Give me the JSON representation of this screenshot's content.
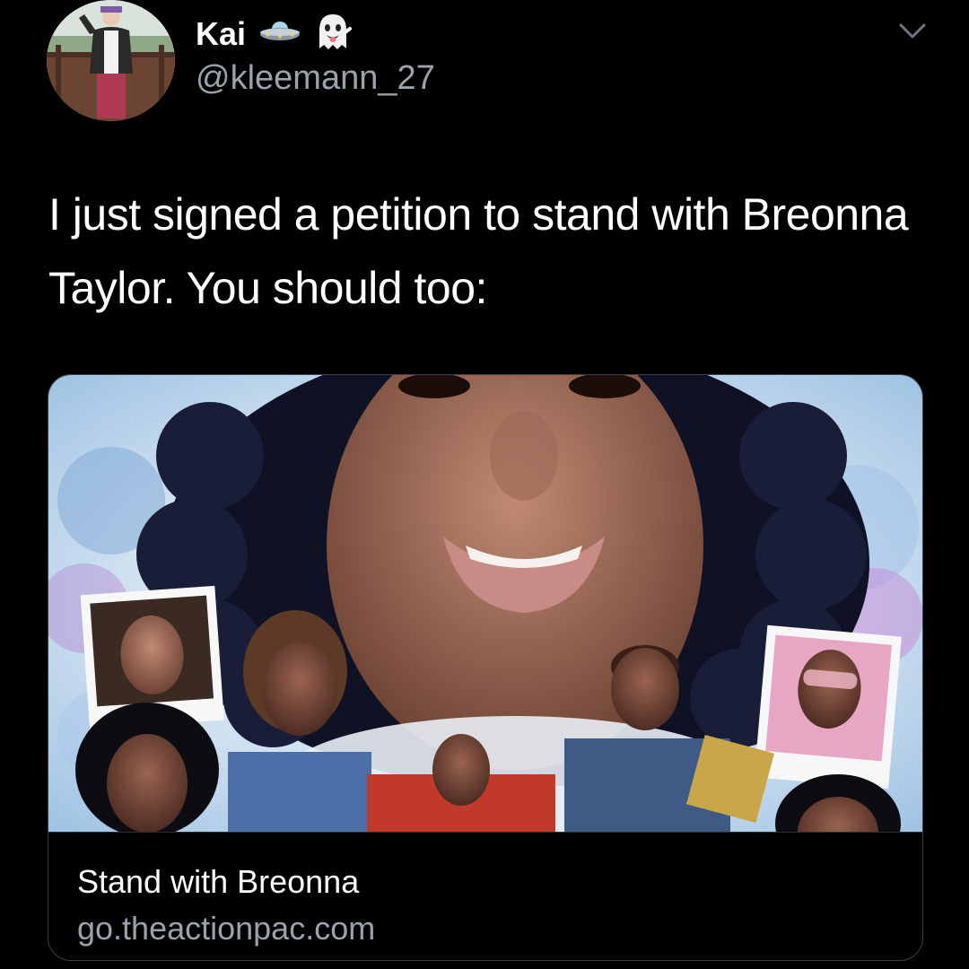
{
  "tweet": {
    "author": {
      "display_name": "Kai",
      "handle": "@kleemann_27",
      "name_emojis": [
        "ufo-emoji",
        "ghost-emoji"
      ]
    },
    "text": "I just signed a petition to stand with Breonna Taylor. You should too:",
    "menu_icon": "chevron-down-icon"
  },
  "link_card": {
    "title": "Stand with Breonna",
    "domain": "go.theactionpac.com",
    "image_description_icon": "collage-image"
  },
  "colors": {
    "background": "#000000",
    "text_primary": "#ffffff",
    "text_secondary": "#9aa3ab",
    "card_border": "#3a3f44"
  }
}
